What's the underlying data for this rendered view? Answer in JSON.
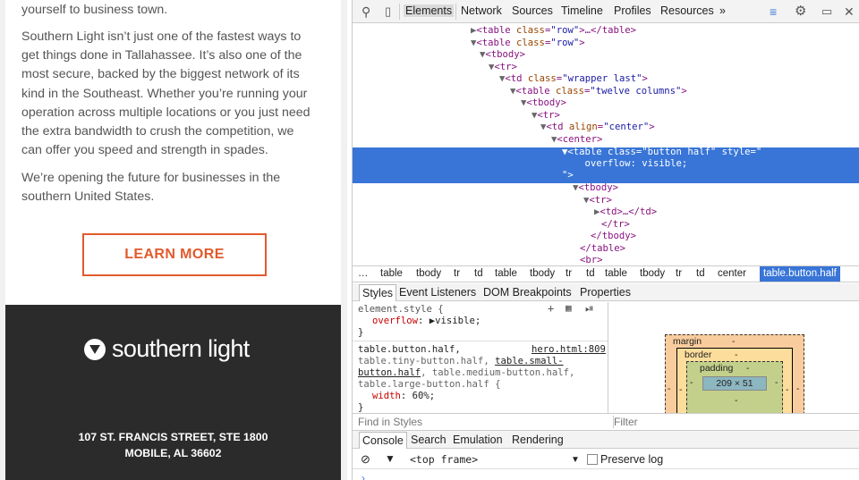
{
  "email": {
    "para0": "yourself to business town.",
    "para1": [
      "Southern Light isn’t just one of the fastest ways to",
      "get things done in Tallahassee. It’s also one of the",
      "most secure, backed by the biggest network of its",
      "kind in the Southeast. Whether you’re running your",
      "operation across multiple locations or you just need",
      "the extra bandwidth to crush the competition, we",
      "can offer you speed and strength in spades."
    ],
    "para2": [
      "We’re opening the future for businesses in the",
      "southern United States."
    ],
    "cta_label": "LEARN MORE",
    "logo_text": "southern light",
    "address_line1": "107 ST. FRANCIS STREET, STE 1800",
    "address_line2": "MOBILE, AL 36602"
  },
  "devtools": {
    "tabs": [
      "Elements",
      "Network",
      "Sources",
      "Timeline",
      "Profiles",
      "Resources"
    ],
    "more": "»",
    "dom_lines": [
      {
        "arrow": "▶",
        "tag": "<table ",
        "attr": "class",
        "val": "\"row\"",
        "tail": ">…</table>"
      },
      {
        "arrow": "▼",
        "tag": "<table ",
        "attr": "class",
        "val": "\"row\"",
        "tail": ">"
      },
      {
        "arrow": "▼",
        "tag": "<tbody>",
        "attr": "",
        "val": "",
        "tail": ""
      },
      {
        "arrow": "▼",
        "tag": "<tr>",
        "attr": "",
        "val": "",
        "tail": ""
      },
      {
        "arrow": "▼",
        "tag": "<td ",
        "attr": "class",
        "val": "\"wrapper last\"",
        "tail": ">"
      },
      {
        "arrow": "▼",
        "tag": "<table ",
        "attr": "class",
        "val": "\"twelve columns\"",
        "tail": ">"
      },
      {
        "arrow": "▼",
        "tag": "<tbody>",
        "attr": "",
        "val": "",
        "tail": ""
      },
      {
        "arrow": "▼",
        "tag": "<tr>",
        "attr": "",
        "val": "",
        "tail": ""
      },
      {
        "arrow": "▼",
        "tag": "<td ",
        "attr": "align",
        "val": "\"center\"",
        "tail": ">"
      },
      {
        "arrow": "▼",
        "tag": "<center>",
        "attr": "",
        "val": "",
        "tail": ""
      }
    ],
    "selected_lines": [
      "▼<table class=\"button half\" style=\"",
      "    overflow: visible;",
      "\">"
    ],
    "dom_after": [
      {
        "arrow": "▼",
        "tag": "<tbody>",
        "tail": ""
      },
      {
        "arrow": "▼",
        "tag": "<tr>",
        "tail": ""
      },
      {
        "arrow": "▶",
        "tag": "<td>",
        "tail": "…</td>"
      },
      {
        "arrow": "",
        "tag": "</tr>",
        "tail": ""
      },
      {
        "arrow": "",
        "tag": "</tbody>",
        "tail": ""
      },
      {
        "arrow": "",
        "tag": "</table>",
        "tail": ""
      },
      {
        "arrow": "",
        "tag": "<br>",
        "tail": ""
      }
    ],
    "breadcrumbs": [
      "…",
      "table",
      "tbody",
      "tr",
      "td",
      "table",
      "tbody",
      "tr",
      "td",
      "table",
      "tbody",
      "tr",
      "td",
      "center",
      "table.button.half"
    ],
    "styles_tabs": [
      "Styles",
      "Event Listeners",
      "DOM Breakpoints",
      "Properties"
    ],
    "element_style_selector": "element.style {",
    "element_style_prop": "overflow",
    "element_style_val": "▶visible;",
    "close_brace": "}",
    "rule_selector_1": "table.button.half,",
    "rule_source": "hero.html:809",
    "rule_selector_2": "table.tiny-button.half, ",
    "rule_selector_2b": "table.small-",
    "rule_selector_3": "button.half",
    "rule_selector_3b": ", table.medium-button.half,",
    "rule_selector_4": "table.large-button.half {",
    "rule_prop": "width",
    "rule_val": "60%;",
    "box_margin": "margin",
    "box_border": "border",
    "box_padding": "padding",
    "box_dash": "-",
    "box_content": "209 × 51",
    "find_placeholder": "Find in Styles",
    "filter_placeholder": "Filter",
    "drawer_tabs": [
      "Console",
      "Search",
      "Emulation",
      "Rendering"
    ],
    "frame_selector": "<top frame>",
    "preserve_log": "Preserve log"
  }
}
